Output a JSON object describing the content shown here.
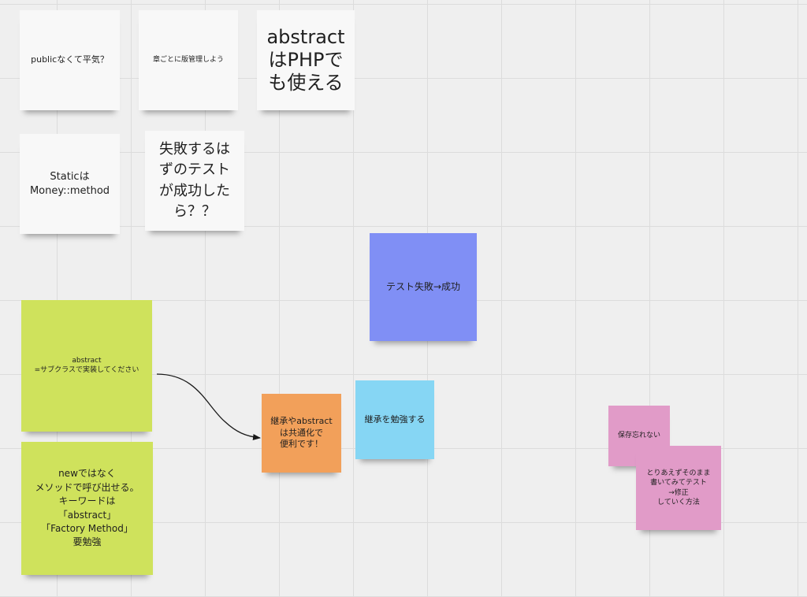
{
  "board": {
    "notes": [
      {
        "text": "publicなくて平気？",
        "color": "white"
      },
      {
        "text": "章ごとに版管理しよう",
        "color": "white"
      },
      {
        "text": "abstract\nはPHPで\nも使える",
        "color": "white"
      },
      {
        "text": "Staticは\nMoney::method",
        "color": "white"
      },
      {
        "text": "失敗するは\nずのテスト\nが成功した\nら？？",
        "color": "white"
      },
      {
        "text": "テスト失敗→成功",
        "color": "blue"
      },
      {
        "text": "abstract\n=サブクラスで実装してください",
        "color": "green"
      },
      {
        "text": "newではなく\nメソッドで呼び出せる。\nキーワードは\n「abstract」\n「Factory Method」\n要勉強",
        "color": "green"
      },
      {
        "text": "継承やabstract\nは共通化で\n便利です！",
        "color": "orange"
      },
      {
        "text": "継承を勉強する",
        "color": "cyan"
      },
      {
        "text": "保存忘れない",
        "color": "pink"
      },
      {
        "text": "とりあえずそのまま\n書いてみてテスト\n→修正\nしていく方法",
        "color": "pink"
      }
    ]
  },
  "colors": {
    "white": "#f8f8f8",
    "green": "#cfe25c",
    "blue": "#808ff5",
    "orange": "#f2a05a",
    "cyan": "#86d6f4",
    "pink": "#e19bc8",
    "connector": "#1a1a1a"
  }
}
